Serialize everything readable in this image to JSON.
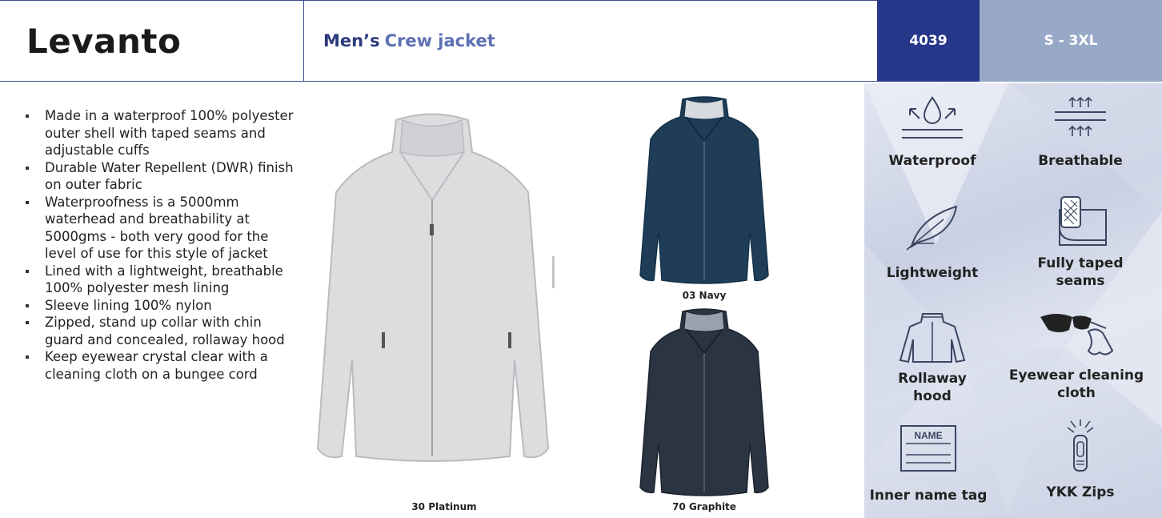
{
  "header": {
    "title": "Levanto",
    "subtitle_prefix": "Men’s",
    "subtitle_main": "Crew jacket",
    "style_code": "4039",
    "size_range": "S - 3XL"
  },
  "features": [
    "Made in a waterproof 100% polyester outer shell with taped seams and adjustable cuffs",
    "Durable Water Repellent (DWR) finish on outer fabric",
    "Waterproofness is a 5000mm waterhead and breathability at 5000gms - both very good for the level of use for this style of jacket",
    "Lined with a lightweight, breathable 100% polyester mesh lining",
    "Sleeve lining 100% nylon",
    "Zipped, stand up collar with chin guard and concealed, rollaway hood",
    "Keep eyewear crystal clear with a cleaning cloth on a bungee cord"
  ],
  "products": [
    {
      "caption": "30 Platinum",
      "color": "#dcdddf"
    },
    {
      "caption": "03 Navy",
      "color": "#1f3d57"
    },
    {
      "caption": "70 Graphite",
      "color": "#2b3442"
    }
  ],
  "icons": [
    {
      "name": "waterproof-icon",
      "label": "Waterproof"
    },
    {
      "name": "breathable-icon",
      "label": "Breathable"
    },
    {
      "name": "lightweight-icon",
      "label": "Lightweight"
    },
    {
      "name": "taped-seams-icon",
      "label": "Fully taped seams"
    },
    {
      "name": "rollaway-hood-icon",
      "label": "Rollaway hood"
    },
    {
      "name": "eyewear-cloth-icon",
      "label": "Eyewear cleaning cloth"
    },
    {
      "name": "name-tag-icon",
      "label": "Inner name tag",
      "tag_text": "NAME"
    },
    {
      "name": "ykk-zip-icon",
      "label": "YKK Zips"
    }
  ],
  "colors": {
    "brand_navy": "#26378a",
    "size_bg": "#98a8c7",
    "subtitle_dark": "#2b3a7d",
    "subtitle_light": "#5d6fb3",
    "icon_stroke": "#3a4561"
  }
}
